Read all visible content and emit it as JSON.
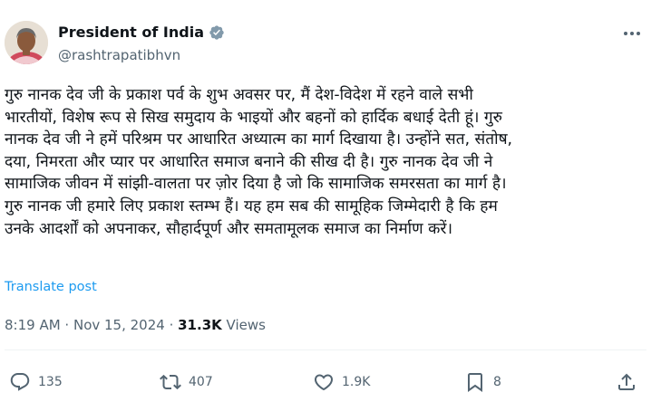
{
  "author": {
    "name": "President of India",
    "handle": "@rashtrapatibhvn",
    "verified": true
  },
  "tweet": {
    "lines": [
      "गुरु नानक देव जी के प्रकाश पर्व के शुभ अवसर पर, मैं देश-विदेश में रहने वाले सभी",
      "भारतीयों, विशेष रूप से सिख समुदाय के भाइयों और बहनों को हार्दिक बधाई देती हूं। गुरु",
      "नानक देव जी ने हमें परिश्रम पर आधारित अध्यात्म का मार्ग दिखाया है। उन्होंने सत, संतोष,",
      "दया, निमरता और प्यार पर आधारित समाज बनाने की सीख दी है। गुरु नानक देव जी ने",
      "सामाजिक जीवन में सांझी-वालता पर ज़ोर दिया है जो कि सामाजिक समरसता का मार्ग है।",
      "गुरु नानक जी हमारे लिए प्रकाश स्तम्भ हैं। यह हम सब की सामूहिक जिम्मेदारी है कि हम",
      "उनके आदर्शों को अपनाकर, सौहार्दपूर्ण और समतामूलक समाज का निर्माण करें।"
    ],
    "translate_label": "Translate post"
  },
  "meta": {
    "time": "8:19 AM",
    "separator": " · ",
    "date": "Nov 15, 2024",
    "views_count": "31.3K",
    "views_label": "Views"
  },
  "actions": {
    "replies": "135",
    "reposts": "407",
    "likes": "1.9K",
    "bookmarks": "8"
  },
  "colors": {
    "link": "#1d9bf0",
    "secondary_text": "#536471",
    "verified_badge": "#829aab"
  },
  "icons": [
    "more-icon",
    "verified-icon",
    "reply-icon",
    "repost-icon",
    "like-icon",
    "bookmark-icon",
    "share-icon"
  ]
}
